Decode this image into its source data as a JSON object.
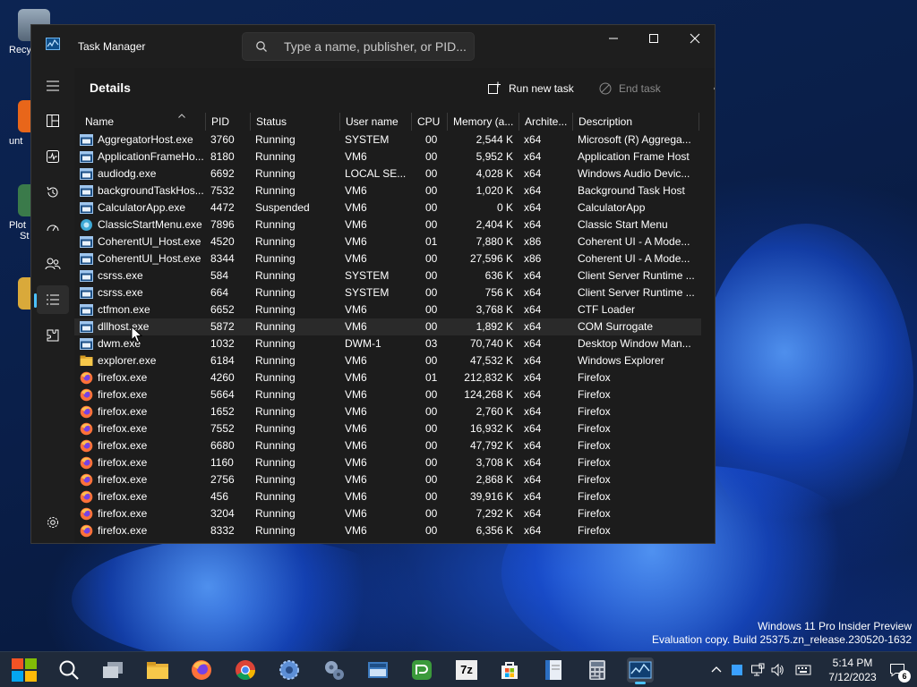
{
  "desktop": {
    "icons": [
      {
        "label": "Recy"
      },
      {
        "label": "unt"
      },
      {
        "label": "Plot"
      },
      {
        "label": "St"
      }
    ],
    "watermark": {
      "line1": "Windows 11 Pro Insider Preview",
      "line2": "Evaluation copy. Build 25375.zn_release.230520-1632"
    }
  },
  "window": {
    "title": "Task Manager",
    "search_placeholder": "Type a name, publisher, or PID..."
  },
  "sidebar": {
    "items": [
      {
        "icon": "hamburger-menu-icon"
      },
      {
        "icon": "processes-icon"
      },
      {
        "icon": "performance-icon"
      },
      {
        "icon": "app-history-icon"
      },
      {
        "icon": "startup-apps-icon"
      },
      {
        "icon": "users-icon"
      },
      {
        "icon": "details-icon",
        "active": true
      },
      {
        "icon": "services-icon"
      },
      {
        "icon": "settings-icon"
      }
    ]
  },
  "page": {
    "title": "Details",
    "run_new_task": "Run new task",
    "end_task": "End task"
  },
  "table": {
    "columns": [
      "Name",
      "PID",
      "Status",
      "User name",
      "CPU",
      "Memory (a...",
      "Archite...",
      "Description"
    ],
    "rows": [
      {
        "name": "AggregatorHost.exe",
        "pid": "3760",
        "status": "Running",
        "user": "SYSTEM",
        "cpu": "00",
        "mem": "2,544 K",
        "arch": "x64",
        "desc": "Microsoft (R) Aggrega...",
        "icon": "app"
      },
      {
        "name": "ApplicationFrameHo...",
        "pid": "8180",
        "status": "Running",
        "user": "VM6",
        "cpu": "00",
        "mem": "5,952 K",
        "arch": "x64",
        "desc": "Application Frame Host",
        "icon": "app"
      },
      {
        "name": "audiodg.exe",
        "pid": "6692",
        "status": "Running",
        "user": "LOCAL SE...",
        "cpu": "00",
        "mem": "4,028 K",
        "arch": "x64",
        "desc": "Windows Audio Devic...",
        "icon": "app"
      },
      {
        "name": "backgroundTaskHos...",
        "pid": "7532",
        "status": "Running",
        "user": "VM6",
        "cpu": "00",
        "mem": "1,020 K",
        "arch": "x64",
        "desc": "Background Task Host",
        "icon": "app"
      },
      {
        "name": "CalculatorApp.exe",
        "pid": "4472",
        "status": "Suspended",
        "user": "VM6",
        "cpu": "00",
        "mem": "0 K",
        "arch": "x64",
        "desc": "CalculatorApp",
        "icon": "app"
      },
      {
        "name": "ClassicStartMenu.exe",
        "pid": "7896",
        "status": "Running",
        "user": "VM6",
        "cpu": "00",
        "mem": "2,404 K",
        "arch": "x64",
        "desc": "Classic Start Menu",
        "icon": "shell"
      },
      {
        "name": "CoherentUI_Host.exe",
        "pid": "4520",
        "status": "Running",
        "user": "VM6",
        "cpu": "01",
        "mem": "7,880 K",
        "arch": "x86",
        "desc": "Coherent UI - A Mode...",
        "icon": "app"
      },
      {
        "name": "CoherentUI_Host.exe",
        "pid": "8344",
        "status": "Running",
        "user": "VM6",
        "cpu": "00",
        "mem": "27,596 K",
        "arch": "x86",
        "desc": "Coherent UI - A Mode...",
        "icon": "app"
      },
      {
        "name": "csrss.exe",
        "pid": "584",
        "status": "Running",
        "user": "SYSTEM",
        "cpu": "00",
        "mem": "636 K",
        "arch": "x64",
        "desc": "Client Server Runtime ...",
        "icon": "app"
      },
      {
        "name": "csrss.exe",
        "pid": "664",
        "status": "Running",
        "user": "SYSTEM",
        "cpu": "00",
        "mem": "756 K",
        "arch": "x64",
        "desc": "Client Server Runtime ...",
        "icon": "app"
      },
      {
        "name": "ctfmon.exe",
        "pid": "6652",
        "status": "Running",
        "user": "VM6",
        "cpu": "00",
        "mem": "3,768 K",
        "arch": "x64",
        "desc": "CTF Loader",
        "icon": "app"
      },
      {
        "name": "dllhost.exe",
        "pid": "5872",
        "status": "Running",
        "user": "VM6",
        "cpu": "00",
        "mem": "1,892 K",
        "arch": "x64",
        "desc": "COM Surrogate",
        "icon": "app",
        "hover": true
      },
      {
        "name": "dwm.exe",
        "pid": "1032",
        "status": "Running",
        "user": "DWM-1",
        "cpu": "03",
        "mem": "70,740 K",
        "arch": "x64",
        "desc": "Desktop Window Man...",
        "icon": "app"
      },
      {
        "name": "explorer.exe",
        "pid": "6184",
        "status": "Running",
        "user": "VM6",
        "cpu": "00",
        "mem": "47,532 K",
        "arch": "x64",
        "desc": "Windows Explorer",
        "icon": "folder"
      },
      {
        "name": "firefox.exe",
        "pid": "4260",
        "status": "Running",
        "user": "VM6",
        "cpu": "01",
        "mem": "212,832 K",
        "arch": "x64",
        "desc": "Firefox",
        "icon": "firefox"
      },
      {
        "name": "firefox.exe",
        "pid": "5664",
        "status": "Running",
        "user": "VM6",
        "cpu": "00",
        "mem": "124,268 K",
        "arch": "x64",
        "desc": "Firefox",
        "icon": "firefox"
      },
      {
        "name": "firefox.exe",
        "pid": "1652",
        "status": "Running",
        "user": "VM6",
        "cpu": "00",
        "mem": "2,760 K",
        "arch": "x64",
        "desc": "Firefox",
        "icon": "firefox"
      },
      {
        "name": "firefox.exe",
        "pid": "7552",
        "status": "Running",
        "user": "VM6",
        "cpu": "00",
        "mem": "16,932 K",
        "arch": "x64",
        "desc": "Firefox",
        "icon": "firefox"
      },
      {
        "name": "firefox.exe",
        "pid": "6680",
        "status": "Running",
        "user": "VM6",
        "cpu": "00",
        "mem": "47,792 K",
        "arch": "x64",
        "desc": "Firefox",
        "icon": "firefox"
      },
      {
        "name": "firefox.exe",
        "pid": "1160",
        "status": "Running",
        "user": "VM6",
        "cpu": "00",
        "mem": "3,708 K",
        "arch": "x64",
        "desc": "Firefox",
        "icon": "firefox"
      },
      {
        "name": "firefox.exe",
        "pid": "2756",
        "status": "Running",
        "user": "VM6",
        "cpu": "00",
        "mem": "2,868 K",
        "arch": "x64",
        "desc": "Firefox",
        "icon": "firefox"
      },
      {
        "name": "firefox.exe",
        "pid": "456",
        "status": "Running",
        "user": "VM6",
        "cpu": "00",
        "mem": "39,916 K",
        "arch": "x64",
        "desc": "Firefox",
        "icon": "firefox"
      },
      {
        "name": "firefox.exe",
        "pid": "3204",
        "status": "Running",
        "user": "VM6",
        "cpu": "00",
        "mem": "7,292 K",
        "arch": "x64",
        "desc": "Firefox",
        "icon": "firefox"
      },
      {
        "name": "firefox.exe",
        "pid": "8332",
        "status": "Running",
        "user": "VM6",
        "cpu": "00",
        "mem": "6,356 K",
        "arch": "x64",
        "desc": "Firefox",
        "icon": "firefox"
      }
    ]
  },
  "taskbar": {
    "apps": [
      {
        "icon": "start-icon"
      },
      {
        "icon": "search-icon"
      },
      {
        "icon": "task-view-icon"
      },
      {
        "icon": "file-explorer-icon"
      },
      {
        "icon": "firefox-icon"
      },
      {
        "icon": "chrome-icon"
      },
      {
        "icon": "settings-gear-icon"
      },
      {
        "icon": "control-panel-icon"
      },
      {
        "icon": "keyboard-app-icon"
      },
      {
        "icon": "green-app-icon"
      },
      {
        "icon": "7zip-icon",
        "text": "7z"
      },
      {
        "icon": "microsoft-store-icon"
      },
      {
        "icon": "notebook-icon"
      },
      {
        "icon": "calculator-icon"
      },
      {
        "icon": "task-manager-icon",
        "active": true
      }
    ],
    "time": "5:14 PM",
    "date": "7/12/2023",
    "notification_count": "6"
  },
  "colors": {
    "accent": "#4cc2ff",
    "window_bg": "#1c1c1c",
    "taskbar_bg": "#1f2a3a"
  }
}
